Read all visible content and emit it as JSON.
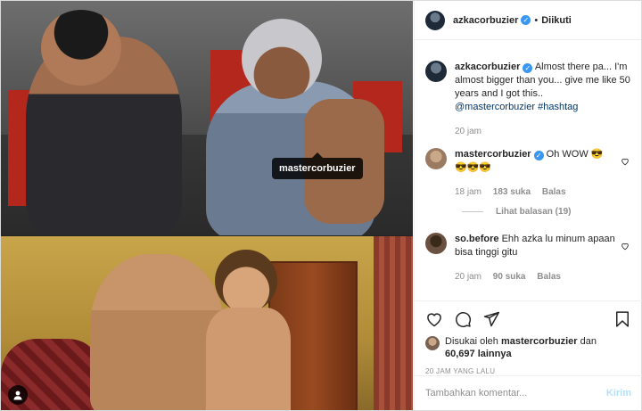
{
  "media": {
    "tag_label": "mastercorbuzier"
  },
  "header": {
    "username": "azkacorbuzier",
    "separator": "•",
    "follow_status": "Diikuti"
  },
  "caption": {
    "username": "azkacorbuzier",
    "text": "Almost there pa... I'm almost bigger than you... give me like 50 years and I got this..",
    "mention": "@mastercorbuzier",
    "hashtag": "#hashtag",
    "time": "20 jam"
  },
  "comments": [
    {
      "username": "mastercorbuzier",
      "line1": "Oh WOW 😎",
      "line2": "😎😎😎",
      "time": "18 jam",
      "likes": "183 suka",
      "reply": "Balas",
      "view_replies": "Lihat balasan (19)"
    },
    {
      "username": "so.before",
      "text": "Ehh azka lu minum apaan bisa tinggi gitu",
      "time": "20 jam",
      "likes": "90 suka",
      "reply": "Balas"
    }
  ],
  "likes": {
    "prefix": "Disukai oleh",
    "user": "mastercorbuzier",
    "conj": "dan",
    "count": "60,697 lainnya"
  },
  "timestamp": "20 JAM YANG LALU",
  "add_comment": {
    "placeholder": "Tambahkan komentar...",
    "post_label": "Kirim"
  },
  "colors": {
    "verified": "#3897f0",
    "link": "#00376b",
    "post_disabled": "#b2dffc"
  }
}
